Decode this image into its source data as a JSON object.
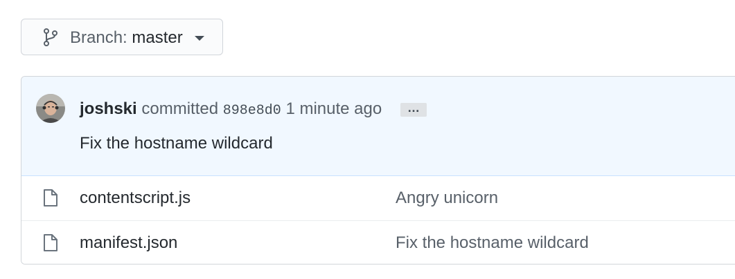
{
  "branch": {
    "prefix": "Branch:",
    "name": "master",
    "icon": "git-branch-icon"
  },
  "commit": {
    "author": "joshski",
    "verb": "committed",
    "sha": "898e8d0",
    "time": "1 minute ago",
    "ellipsis": "…",
    "message": "Fix the hostname wildcard",
    "avatar_icon": "avatar"
  },
  "files": [
    {
      "name": "contentscript.js",
      "message": "Angry unicorn",
      "icon": "file-icon"
    },
    {
      "name": "manifest.json",
      "message": "Fix the hostname wildcard",
      "icon": "file-icon"
    }
  ],
  "colors": {
    "header_bg": "#f1f8ff",
    "border": "#d1d5da",
    "text": "#24292e",
    "muted": "#586069"
  }
}
